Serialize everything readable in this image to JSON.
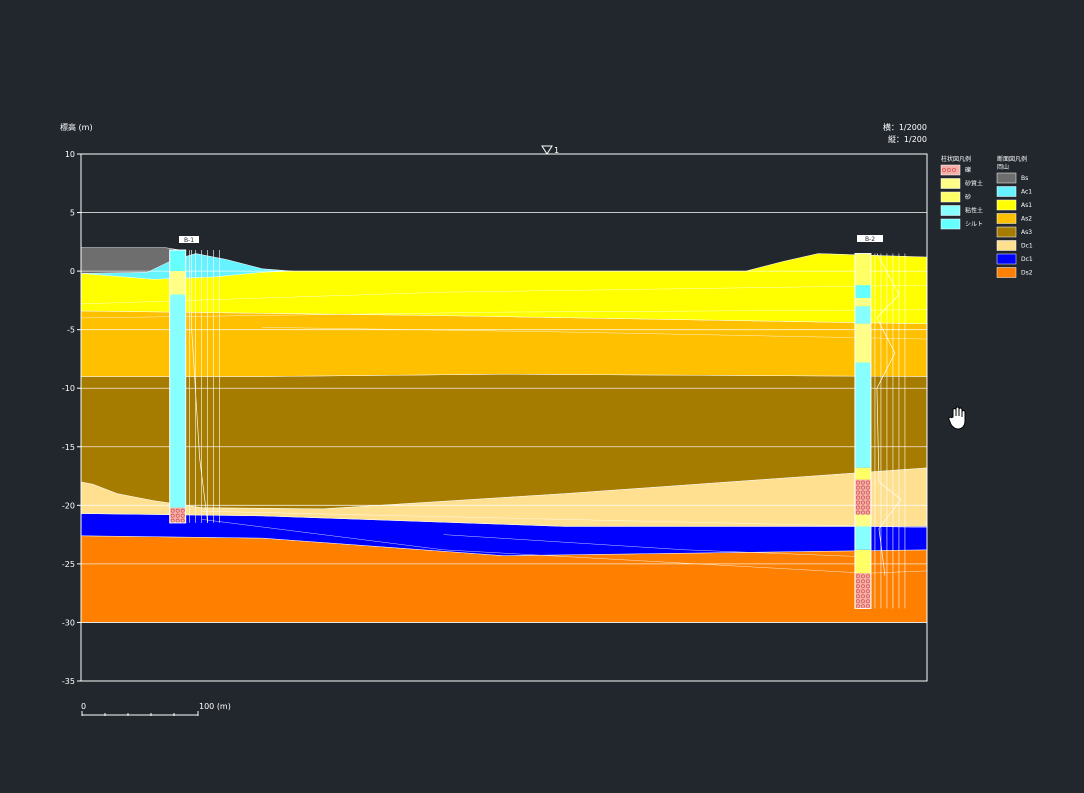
{
  "header": {
    "y_axis_title": "標高 (m)",
    "scale_h": "横：1/2000",
    "scale_v": "縦：1/200",
    "water_marker": "1"
  },
  "y_axis": {
    "min": -35,
    "max": 10,
    "step": 5,
    "ticks": [
      "10",
      "5",
      "0",
      "-5",
      "-10",
      "-15",
      "-20",
      "-25",
      "-30",
      "-35"
    ]
  },
  "scale_bar": {
    "start_label": "0",
    "end_label": "100 (m)"
  },
  "legend_columns": {
    "title": "柱状図凡例",
    "items": [
      {
        "label": "礫",
        "color": "#f4b0a8",
        "pattern": "gravel"
      },
      {
        "label": "砂質土",
        "color": "#ffff88",
        "pattern": "none"
      },
      {
        "label": "砂",
        "color": "#ffff66",
        "pattern": "none"
      },
      {
        "label": "粘性土",
        "color": "#88ffff",
        "pattern": "none"
      },
      {
        "label": "シルト",
        "color": "#66ffff",
        "pattern": "none"
      }
    ]
  },
  "legend_section": {
    "title": "断面図凡例",
    "subtitle": "岡山",
    "items": [
      {
        "label": "Bs",
        "color": "#6e6e6e"
      },
      {
        "label": "Ac1",
        "color": "#66f2ff"
      },
      {
        "label": "As1",
        "color": "#ffff00"
      },
      {
        "label": "As2",
        "color": "#ffc000"
      },
      {
        "label": "As3",
        "color": "#a67c00"
      },
      {
        "label": "Dc1",
        "color": "#ffe090"
      },
      {
        "label": "Dc1",
        "color": "#0000ff"
      },
      {
        "label": "Ds2",
        "color": "#ff8000"
      }
    ]
  },
  "boreholes": [
    {
      "id": "left",
      "tag": "B-1"
    },
    {
      "id": "right",
      "tag": "B-2"
    }
  ],
  "chart_data": {
    "type": "geologic-cross-section",
    "ylabel": "標高 (m)",
    "ylim": [
      -35,
      10
    ],
    "xlim": [
      0,
      700
    ],
    "layers": [
      {
        "name": "Ds2",
        "color": "#ff8000",
        "top": [
          [
            0,
            -22.6
          ],
          [
            150,
            -22.8
          ],
          [
            350,
            -24.3
          ],
          [
            700,
            -23.8
          ]
        ],
        "bottom": [
          [
            0,
            -30
          ],
          [
            700,
            -30
          ]
        ]
      },
      {
        "name": "Dc1",
        "color": "#0000ff",
        "top": [
          [
            0,
            -20.7
          ],
          [
            150,
            -20.9
          ],
          [
            400,
            -21.8
          ],
          [
            700,
            -21.8
          ]
        ],
        "bottom": [
          [
            0,
            -22.6
          ],
          [
            150,
            -22.8
          ],
          [
            350,
            -24.3
          ],
          [
            700,
            -23.8
          ]
        ]
      },
      {
        "name": "Dc1",
        "color": "#ffe090",
        "top": [
          [
            0,
            -18
          ],
          [
            10,
            -18.2
          ],
          [
            30,
            -19
          ],
          [
            60,
            -19.6
          ],
          [
            100,
            -20.2
          ],
          [
            200,
            -20.3
          ],
          [
            400,
            -19
          ],
          [
            700,
            -16.8
          ]
        ],
        "bottom": [
          [
            0,
            -20.7
          ],
          [
            150,
            -20.9
          ],
          [
            400,
            -21.8
          ],
          [
            700,
            -21.8
          ]
        ]
      },
      {
        "name": "As3",
        "color": "#a67c00",
        "top": [
          [
            0,
            -9
          ],
          [
            150,
            -9
          ],
          [
            350,
            -8.8
          ],
          [
            700,
            -9
          ]
        ],
        "bottom": [
          [
            0,
            -18
          ],
          [
            10,
            -18.2
          ],
          [
            30,
            -19
          ],
          [
            60,
            -19.6
          ],
          [
            100,
            -20.2
          ],
          [
            200,
            -20.3
          ],
          [
            400,
            -19
          ],
          [
            700,
            -16.8
          ]
        ]
      },
      {
        "name": "As2",
        "color": "#ffc000",
        "top": [
          [
            0,
            -3.4
          ],
          [
            300,
            -3.8
          ],
          [
            700,
            -4.5
          ]
        ],
        "bottom": [
          [
            0,
            -9
          ],
          [
            150,
            -9
          ],
          [
            350,
            -8.8
          ],
          [
            700,
            -9
          ]
        ]
      },
      {
        "name": "As1",
        "color": "#ffff00",
        "top": [
          [
            0,
            0
          ],
          [
            110,
            0
          ],
          [
            175,
            0
          ],
          [
            550,
            0
          ],
          [
            580,
            0.8
          ],
          [
            610,
            1.5
          ],
          [
            700,
            1.2
          ]
        ],
        "bottom": [
          [
            0,
            -3.4
          ],
          [
            300,
            -3.8
          ],
          [
            700,
            -4.5
          ]
        ]
      },
      {
        "name": "Ac1",
        "color": "#66f2ff",
        "top": [
          [
            0,
            -0.2
          ],
          [
            55,
            0
          ],
          [
            75,
            0.9
          ],
          [
            95,
            1.5
          ],
          [
            120,
            1
          ],
          [
            150,
            0.2
          ],
          [
            175,
            0
          ]
        ],
        "bottom": [
          [
            0,
            -0.2
          ],
          [
            60,
            -0.7
          ],
          [
            110,
            -0.5
          ],
          [
            150,
            -0.1
          ],
          [
            175,
            0
          ]
        ]
      },
      {
        "name": "Bs",
        "color": "#6e6e6e",
        "top": [
          [
            0,
            2
          ],
          [
            70,
            2
          ],
          [
            82,
            1.8
          ]
        ],
        "bottom": [
          [
            0,
            -0.2
          ],
          [
            55,
            -0.1
          ],
          [
            75,
            0.9
          ],
          [
            82,
            1.8
          ]
        ]
      }
    ],
    "boreholes": [
      {
        "x": 80,
        "top": 1.8,
        "bottom": -21.5,
        "segments": [
          [
            1.8,
            0,
            "#66ffff"
          ],
          [
            0,
            -2,
            "#ffff88"
          ],
          [
            -2,
            -20.2,
            "#88ffff"
          ],
          [
            -20.2,
            -21.5,
            "#f4b0a8"
          ]
        ]
      },
      {
        "x": 647,
        "top": 1.5,
        "bottom": -28.8,
        "segments": [
          [
            1.5,
            -1.2,
            "#ffff66"
          ],
          [
            -1.2,
            -2.3,
            "#66ffff"
          ],
          [
            -2.3,
            -3,
            "#ffff88"
          ],
          [
            -3,
            -4.5,
            "#88ffff"
          ],
          [
            -4.5,
            -7.8,
            "#ffff88"
          ],
          [
            -7.8,
            -16.8,
            "#88ffff"
          ],
          [
            -16.8,
            -17.8,
            "#ffff66"
          ],
          [
            -17.8,
            -20.8,
            "#f4b0a8"
          ],
          [
            -20.8,
            -21.8,
            "#ffff88"
          ],
          [
            -21.8,
            -23.8,
            "#88ffff"
          ],
          [
            -23.8,
            -25.8,
            "#ffff66"
          ],
          [
            -25.8,
            -28.8,
            "#f4b0a8"
          ]
        ]
      }
    ],
    "hlines": [
      5,
      0,
      -5,
      -10,
      -15,
      -20,
      -25,
      -30
    ]
  }
}
